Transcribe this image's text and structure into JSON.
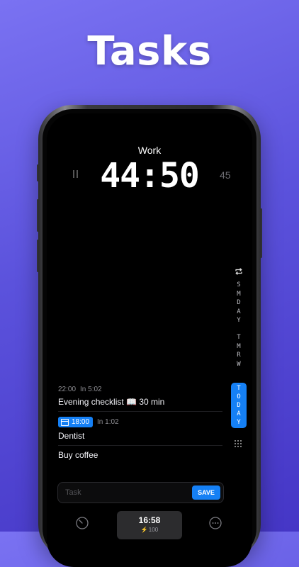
{
  "headline": "Tasks",
  "timer": {
    "mode_label": "Work",
    "time": "44:50",
    "duration": "45",
    "state": "running"
  },
  "rail": {
    "someday": "S\nM\nD\nA\nY",
    "tomorrow": "T\nM\nR\nW",
    "today": "T\nO\nD\nA\nY",
    "selected": "today"
  },
  "tasks": [
    {
      "meta_time": "22:00",
      "meta_in": "In 5:02",
      "title": "Evening checklist 📖 30 min"
    },
    {
      "chip_time": "18:00",
      "meta_in": "In 1:02",
      "title": "Dentist"
    },
    {
      "title": "Buy coffee"
    }
  ],
  "input": {
    "placeholder": "Task",
    "value": ""
  },
  "save_label": "SAVE",
  "clock": {
    "time": "16:58",
    "energy": "100"
  },
  "colors": {
    "accent": "#1580f5",
    "background_top": "#7a72f2",
    "background_bottom": "#4536c6"
  },
  "icons": [
    "pause-icon",
    "repeat-icon",
    "calendar-icon",
    "grid-icon",
    "timer-icon",
    "bolt-icon",
    "more-icon"
  ]
}
